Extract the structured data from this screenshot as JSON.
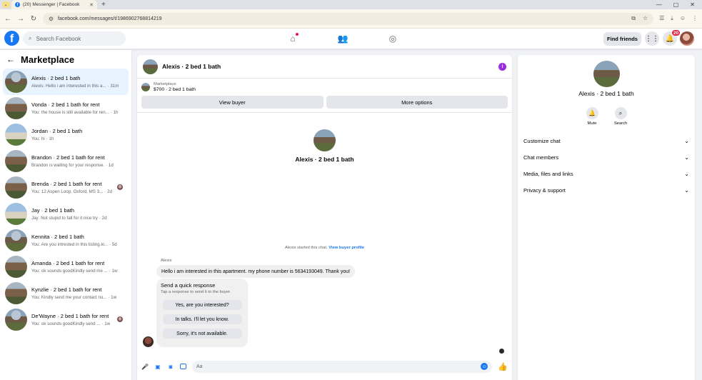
{
  "browser": {
    "tab_title": "(20) Messenger | Facebook",
    "url": "facebook.com/messages/t/1986902768814219"
  },
  "header": {
    "search_placeholder": "Search Facebook",
    "find_friends": "Find friends",
    "notif_count": "20"
  },
  "left": {
    "title": "Marketplace",
    "conversations": [
      {
        "name": "Alexis · 2 bed 1 bath",
        "preview": "Alexis: Hello i am interested in this a...",
        "time": "· 31m",
        "active": true
      },
      {
        "name": "Vonda · 2 bed 1 bath for rent",
        "preview": "You: the house is still available for ren...",
        "time": "· 1h"
      },
      {
        "name": "Jordan · 2 bed 1 bath",
        "preview": "You: hi",
        "time": "· 1h"
      },
      {
        "name": "Brandon · 2 bed 1 bath for rent",
        "preview": "Brandon is waiting for your response.",
        "time": "· 1d"
      },
      {
        "name": "Brenda · 2 bed 1 bath for rent",
        "preview": "You: 12 Aspen Loop, Oxford, MS 3...",
        "time": "· 2d"
      },
      {
        "name": "Jay · 2 bed 1 bath",
        "preview": "Jay: Not stupid to fall for it nice try",
        "time": "· 2d"
      },
      {
        "name": "Kennita · 2 bed 1 bath",
        "preview": "You: Are you intrested in this listing.ki...",
        "time": "· 5d"
      },
      {
        "name": "Amanda · 2 bed 1 bath for rent",
        "preview": "You: ok sounds goodKindly send me ...",
        "time": "· 1w"
      },
      {
        "name": "Kynzlie · 2 bed 1 bath for rent",
        "preview": "You: Kindly send me your contact nu...",
        "time": "· 1w"
      },
      {
        "name": "De'Wayne · 2 bed 1 bath for rent",
        "preview": "You: ok sounds goodKindly send ...",
        "time": "· 1w"
      }
    ]
  },
  "chat": {
    "title": "Alexis · 2 bed 1 bath",
    "marketplace_label": "Marketplace",
    "listing": "$700 · 2 bed 1 bath",
    "view_buyer": "View buyer",
    "more_options": "More options",
    "profile_name": "Alexis · 2 bed 1 bath",
    "started_text": "Alexis started this chat.",
    "view_buyer_profile": "View buyer profile",
    "sender": "Alexis",
    "message": "Hello i am interested in this apartment. my phone number is 5634193049. Thank you!",
    "quick_title": "Send a quick response",
    "quick_sub": "Tap a response to send it to the buyer.",
    "quick_options": [
      "Yes, are you interested?",
      "In talks. I'll let you know.",
      "Sorry, it's not available."
    ],
    "composer_placeholder": "Aa"
  },
  "right": {
    "name": "Alexis · 2 bed 1 bath",
    "mute": "Mute",
    "search": "Search",
    "menu": [
      "Customize chat",
      "Chat members",
      "Media, files and links",
      "Privacy & support"
    ]
  }
}
